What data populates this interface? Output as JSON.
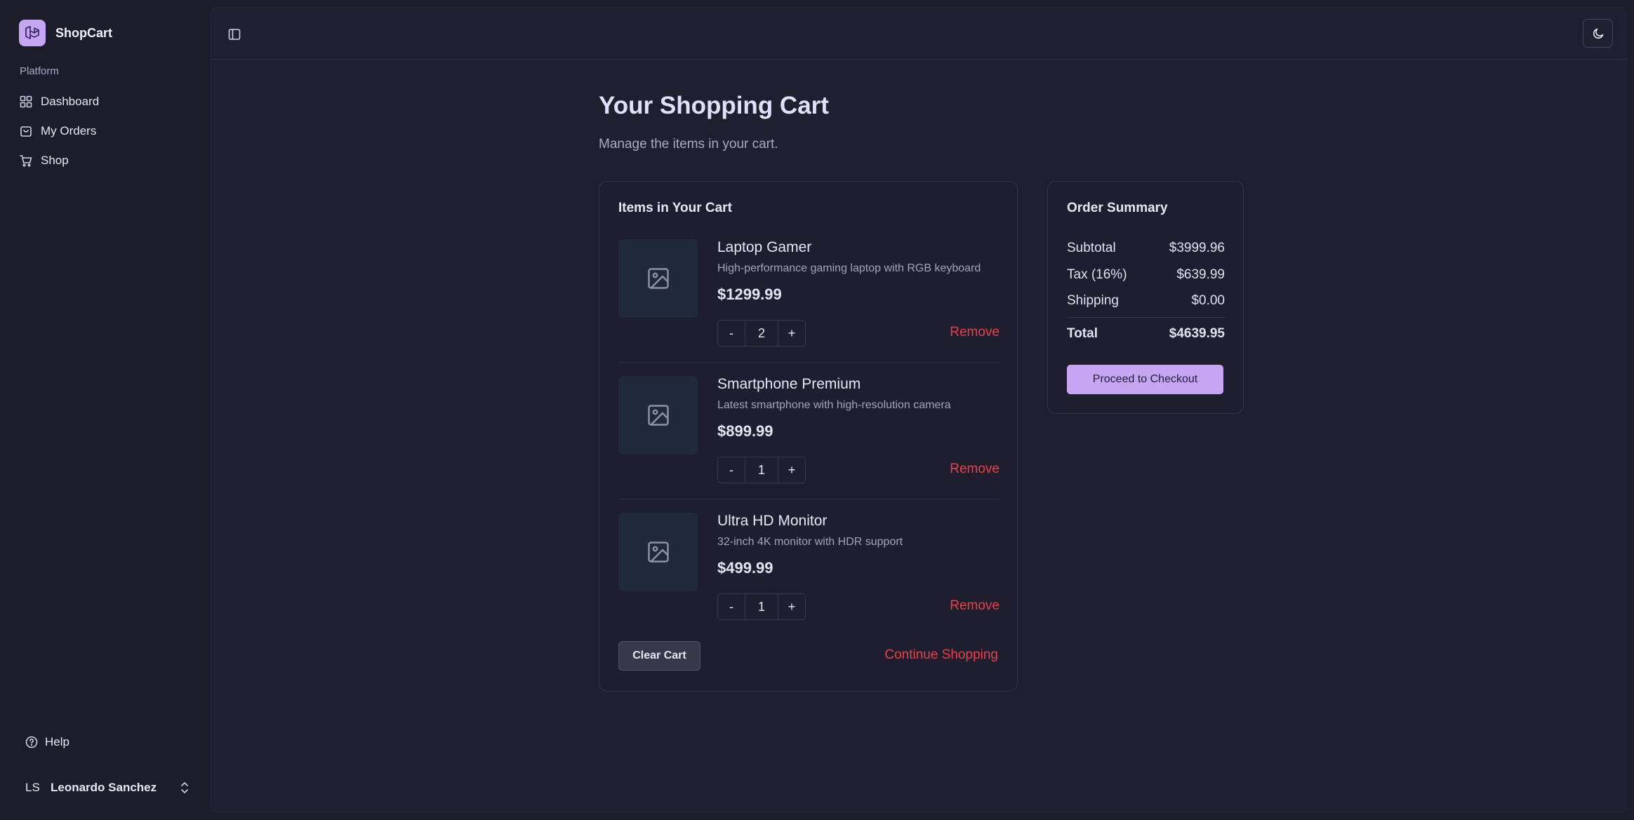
{
  "brand": {
    "name": "ShopCart"
  },
  "sidebar": {
    "section_label": "Platform",
    "items": [
      {
        "label": "Dashboard",
        "icon": "grid-icon"
      },
      {
        "label": "My Orders",
        "icon": "shopping-bag-icon"
      },
      {
        "label": "Shop",
        "icon": "cart-icon"
      }
    ],
    "help_label": "Help",
    "user": {
      "initials": "LS",
      "name": "Leonardo Sanchez"
    }
  },
  "page": {
    "title": "Your Shopping Cart",
    "subtitle": "Manage the items in your cart."
  },
  "cart": {
    "title": "Items in Your Cart",
    "items": [
      {
        "name": "Laptop Gamer",
        "description": "High-performance gaming laptop with RGB keyboard",
        "price": "$1299.99",
        "quantity": "2",
        "remove_label": "Remove"
      },
      {
        "name": "Smartphone Premium",
        "description": "Latest smartphone with high-resolution camera",
        "price": "$899.99",
        "quantity": "1",
        "remove_label": "Remove"
      },
      {
        "name": "Ultra HD Monitor",
        "description": "32-inch 4K monitor with HDR support",
        "price": "$499.99",
        "quantity": "1",
        "remove_label": "Remove"
      }
    ],
    "decrement_label": "-",
    "increment_label": "+",
    "clear_label": "Clear Cart",
    "continue_label": "Continue Shopping"
  },
  "summary": {
    "title": "Order Summary",
    "subtotal_label": "Subtotal",
    "subtotal_value": "$3999.96",
    "tax_label": "Tax (16%)",
    "tax_value": "$639.99",
    "shipping_label": "Shipping",
    "shipping_value": "$0.00",
    "total_label": "Total",
    "total_value": "$4639.95",
    "checkout_label": "Proceed to Checkout"
  },
  "colors": {
    "accent": "#c7a5f3",
    "danger": "#ee3f49",
    "background": "#1c1c2b"
  }
}
